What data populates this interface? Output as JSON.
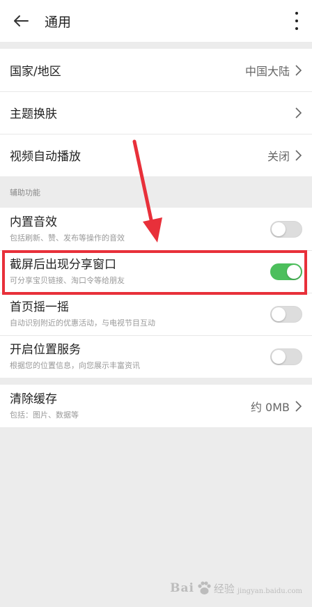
{
  "header": {
    "title": "通用"
  },
  "region_group": {
    "country": {
      "label": "国家/地区",
      "value": "中国大陆"
    },
    "theme": {
      "label": "主题换肤"
    },
    "autoplay": {
      "label": "视频自动播放",
      "value": "关闭"
    }
  },
  "assist": {
    "section_label": "辅助功能",
    "items": [
      {
        "title": "内置音效",
        "desc": "包括刷新、赞、发布等操作的音效",
        "on": false
      },
      {
        "title": "截屏后出现分享窗口",
        "desc": "可分享宝贝链接、淘口令等给朋友",
        "on": true
      },
      {
        "title": "首页摇一摇",
        "desc": "自动识别附近的优惠活动，与电视节目互动",
        "on": false
      },
      {
        "title": "开启位置服务",
        "desc": "根据您的位置信息，向您展示丰富资讯",
        "on": false
      }
    ]
  },
  "cache": {
    "title": "清除缓存",
    "desc": "包括：图片、数据等",
    "value": "约 0MB"
  },
  "watermark": {
    "brand": "Bai",
    "text": "经验",
    "domain": "jingyan.baidu.com"
  },
  "colors": {
    "toggle_on": "#4cbf5c",
    "highlight": "#e8303a",
    "background": "#ececec"
  }
}
